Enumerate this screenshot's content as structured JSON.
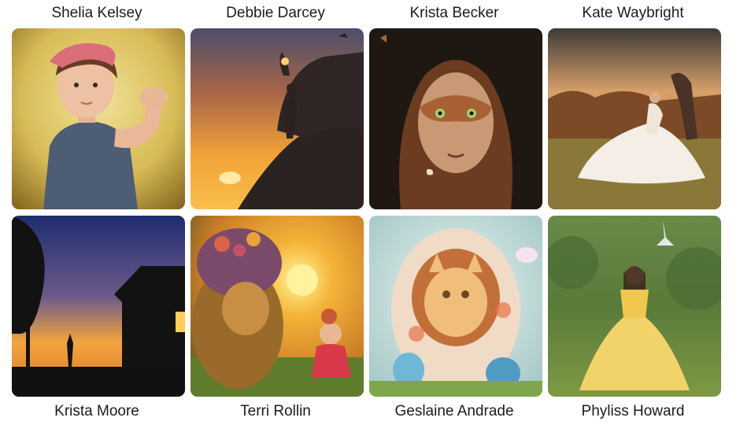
{
  "gallery": {
    "items": [
      {
        "artist": "Shelia Kelsey"
      },
      {
        "artist": "Debbie Darcey"
      },
      {
        "artist": "Krista Becker"
      },
      {
        "artist": "Kate Waybright"
      },
      {
        "artist": "Krista Moore"
      },
      {
        "artist": "Terri Rollin"
      },
      {
        "artist": "Geslaine Andrade"
      },
      {
        "artist": "Phyliss Howard"
      }
    ]
  },
  "colors": {
    "page_background": "#ffffff",
    "text": "#1c1c1c"
  }
}
